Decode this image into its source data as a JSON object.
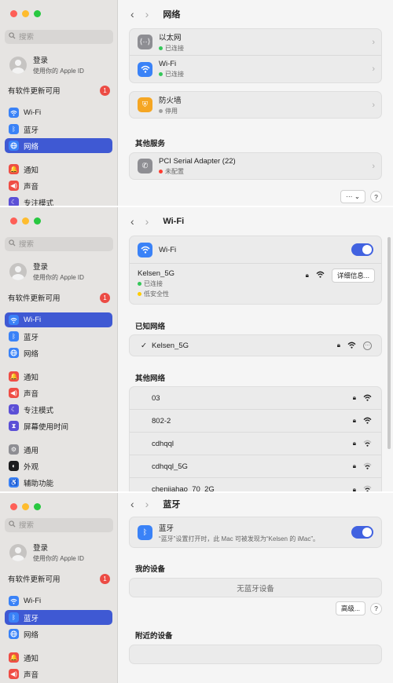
{
  "sidebar": {
    "search_placeholder": "搜索",
    "account_title": "登录",
    "account_sub": "使用你的 Apple ID",
    "update_label": "有软件更新可用",
    "update_count": "1"
  },
  "nav": {
    "wifi": "Wi-Fi",
    "bluetooth": "蓝牙",
    "network": "网络",
    "notifications": "通知",
    "sound": "声音",
    "focus": "专注模式",
    "screen_time": "屏幕使用时间",
    "general": "通用",
    "appearance": "外观",
    "accessibility": "辅助功能"
  },
  "network_panel": {
    "title": "网络",
    "services": [
      {
        "name": "以太网",
        "status": "已连接"
      },
      {
        "name": "Wi-Fi",
        "status": "已连接"
      },
      {
        "name": "防火墙",
        "status": "停用"
      }
    ],
    "other_header": "其他服务",
    "pci_name": "PCI Serial Adapter (22)",
    "pci_status": "未配置",
    "more_button": "··· ⌄",
    "help": "?"
  },
  "wifi_panel": {
    "title": "Wi-Fi",
    "wifi_label": "Wi-Fi",
    "current_network": "Kelsen_5G",
    "connected": "已连接",
    "low_security": "低安全性",
    "details_button": "详细信息...",
    "known_header": "已知网络",
    "known_network": "Kelsen_5G",
    "other_header": "其他网络",
    "other_networks": [
      "03",
      "802-2",
      "cdhqql",
      "cdhqql_5G",
      "chenjiahao_70_2G"
    ]
  },
  "bt_panel": {
    "title": "蓝牙",
    "bt_label": "蓝牙",
    "bt_desc": "“蓝牙”设置打开时，此 Mac 可被发现为“Kelsen 的 iMac”。",
    "my_devices_header": "我的设备",
    "no_devices": "无蓝牙设备",
    "advanced_button": "高级...",
    "help": "?",
    "nearby_header": "附近的设备"
  },
  "colors": {
    "accent": "#3f59d3",
    "toggle_on": "#4162e0",
    "status_green": "#34c759",
    "status_red": "#ff3b30",
    "status_gray": "#a0a0a0",
    "status_yellow": "#ffcc00"
  }
}
